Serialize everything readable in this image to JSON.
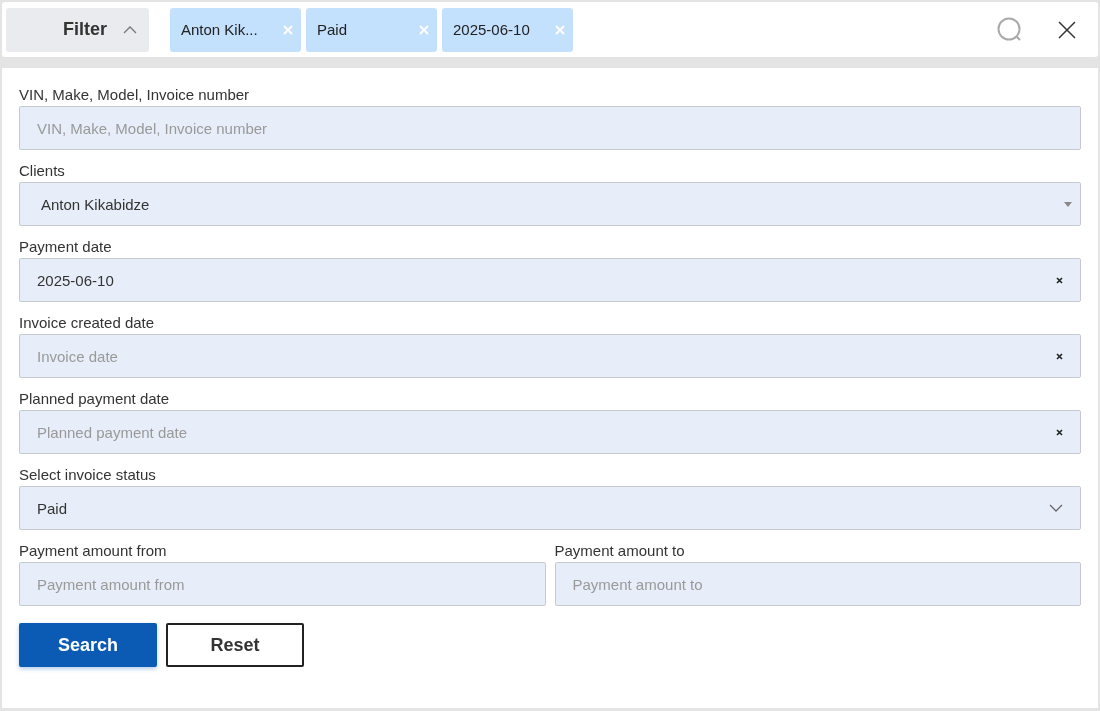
{
  "filter_button": {
    "label": "Filter",
    "expanded": true
  },
  "chips": [
    {
      "label": "Anton Kik..."
    },
    {
      "label": "Paid"
    },
    {
      "label": "2025-06-10"
    }
  ],
  "rows": [
    [
      {
        "kind": "text",
        "label": "VIN, Make, Model, Invoice number",
        "placeholder": "VIN, Make, Model, Invoice number"
      }
    ],
    [
      {
        "kind": "select",
        "label": "Clients",
        "value": "Anton Kikabidze"
      }
    ],
    [
      {
        "kind": "date",
        "label": "Payment date",
        "value": "2025-06-10"
      }
    ],
    [
      {
        "kind": "date",
        "label": "Invoice created date",
        "placeholder": "Invoice date"
      }
    ],
    [
      {
        "kind": "date",
        "label": "Planned payment date",
        "placeholder": "Planned payment date"
      }
    ],
    [
      {
        "kind": "dropdown",
        "label": "Select invoice status",
        "value": "Paid"
      }
    ],
    [
      {
        "kind": "text",
        "label": "Payment amount from",
        "placeholder": "Payment amount from"
      },
      {
        "kind": "text",
        "label": "Payment amount to",
        "placeholder": "Payment amount to"
      }
    ]
  ],
  "buttons": [
    {
      "kind": "primary",
      "label": "Search"
    },
    {
      "kind": "secondary",
      "label": "Reset"
    }
  ]
}
